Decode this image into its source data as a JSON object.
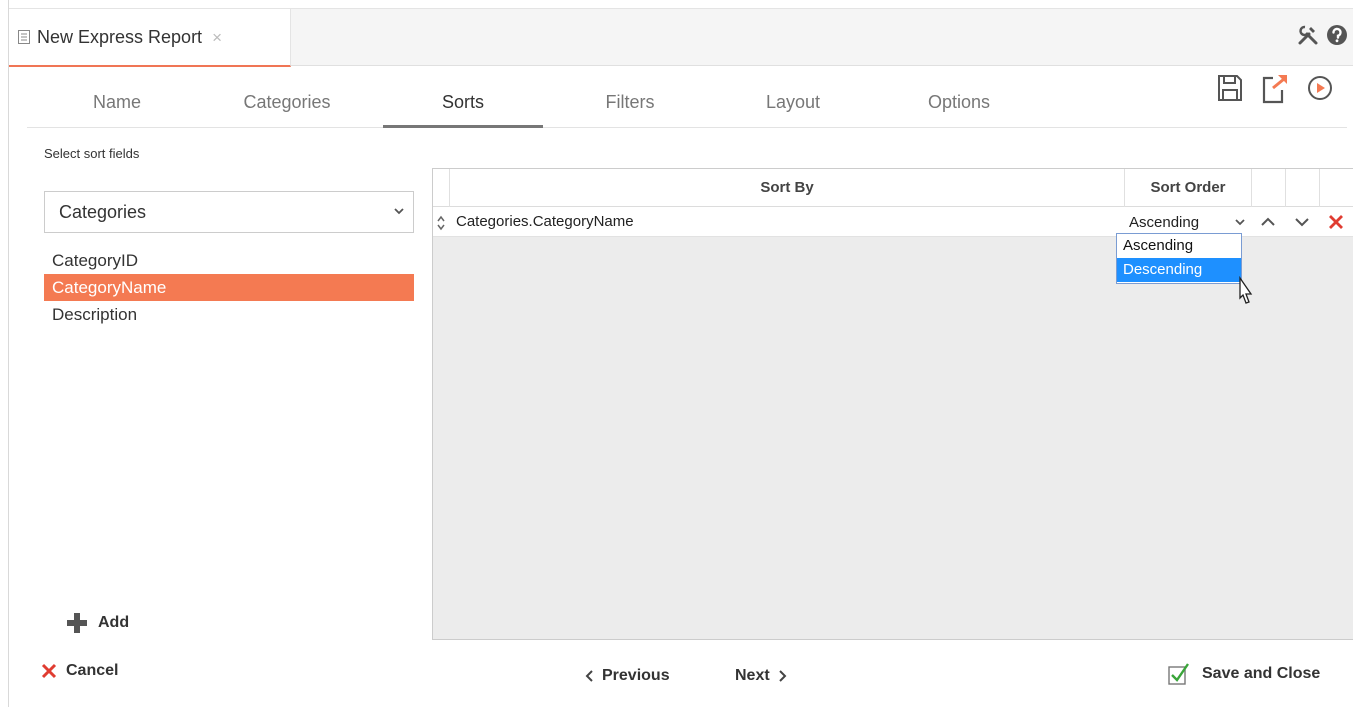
{
  "document_tab": {
    "title": "New Express Report",
    "close_glyph": "×"
  },
  "header_tools": {
    "tools_icon": "tools-icon",
    "help_icon": "help-icon"
  },
  "steps": [
    {
      "label": "Name"
    },
    {
      "label": "Categories"
    },
    {
      "label": "Sorts",
      "active": true
    },
    {
      "label": "Filters"
    },
    {
      "label": "Layout"
    },
    {
      "label": "Options"
    }
  ],
  "step_actions": {
    "save_icon": "save-icon",
    "export_icon": "export-icon",
    "run_icon": "run-icon"
  },
  "left_panel": {
    "section_label": "Select sort fields",
    "table_select": {
      "value": "Categories"
    },
    "fields": [
      "CategoryID",
      "CategoryName",
      "Description"
    ],
    "selected_field": "CategoryName",
    "add_label": "Add"
  },
  "grid": {
    "headers": {
      "sort_by": "Sort By",
      "sort_order": "Sort Order"
    },
    "rows": [
      {
        "field": "Categories.CategoryName",
        "order": "Ascending"
      }
    ],
    "order_options": [
      "Ascending",
      "Descending"
    ],
    "highlighted_option": "Descending"
  },
  "footer": {
    "cancel_label": "Cancel",
    "previous_label": "Previous",
    "next_label": "Next",
    "save_close_label": "Save and Close"
  },
  "colors": {
    "accent": "#f47a52",
    "highlight_blue": "#1e90ff",
    "delete_red": "#e03c31",
    "check_green": "#3aa53a"
  }
}
